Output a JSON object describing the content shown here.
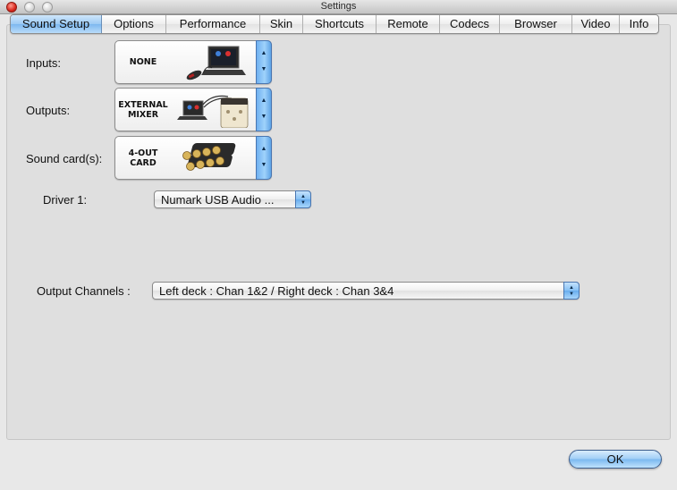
{
  "window": {
    "title": "Settings"
  },
  "tabs": [
    {
      "label": "Sound Setup",
      "active": true
    },
    {
      "label": "Options"
    },
    {
      "label": "Performance"
    },
    {
      "label": "Skin"
    },
    {
      "label": "Shortcuts"
    },
    {
      "label": "Remote"
    },
    {
      "label": "Codecs"
    },
    {
      "label": "Browser"
    },
    {
      "label": "Video"
    },
    {
      "label": "Info"
    }
  ],
  "sound_setup": {
    "inputs": {
      "label": "Inputs:",
      "value": "NONE",
      "icon": "laptop-with-mouse-icon"
    },
    "outputs": {
      "label": "Outputs:",
      "value": "EXTERNAL MIXER",
      "icon": "laptop-and-mixer-icon"
    },
    "sound_cards": {
      "label": "Sound card(s):",
      "value": "4-OUT CARD",
      "icon": "rca-connectors-icon"
    },
    "driver": {
      "label": "Driver 1:",
      "value": "Numark USB Audio ..."
    },
    "output_channels": {
      "label": "Output Channels :",
      "value": "Left deck : Chan 1&2 / Right deck : Chan 3&4"
    }
  },
  "footer": {
    "ok_label": "OK"
  },
  "colors": {
    "accent": "#7db8ef",
    "panel": "#dfdfdf",
    "background": "#e8e8e8"
  }
}
